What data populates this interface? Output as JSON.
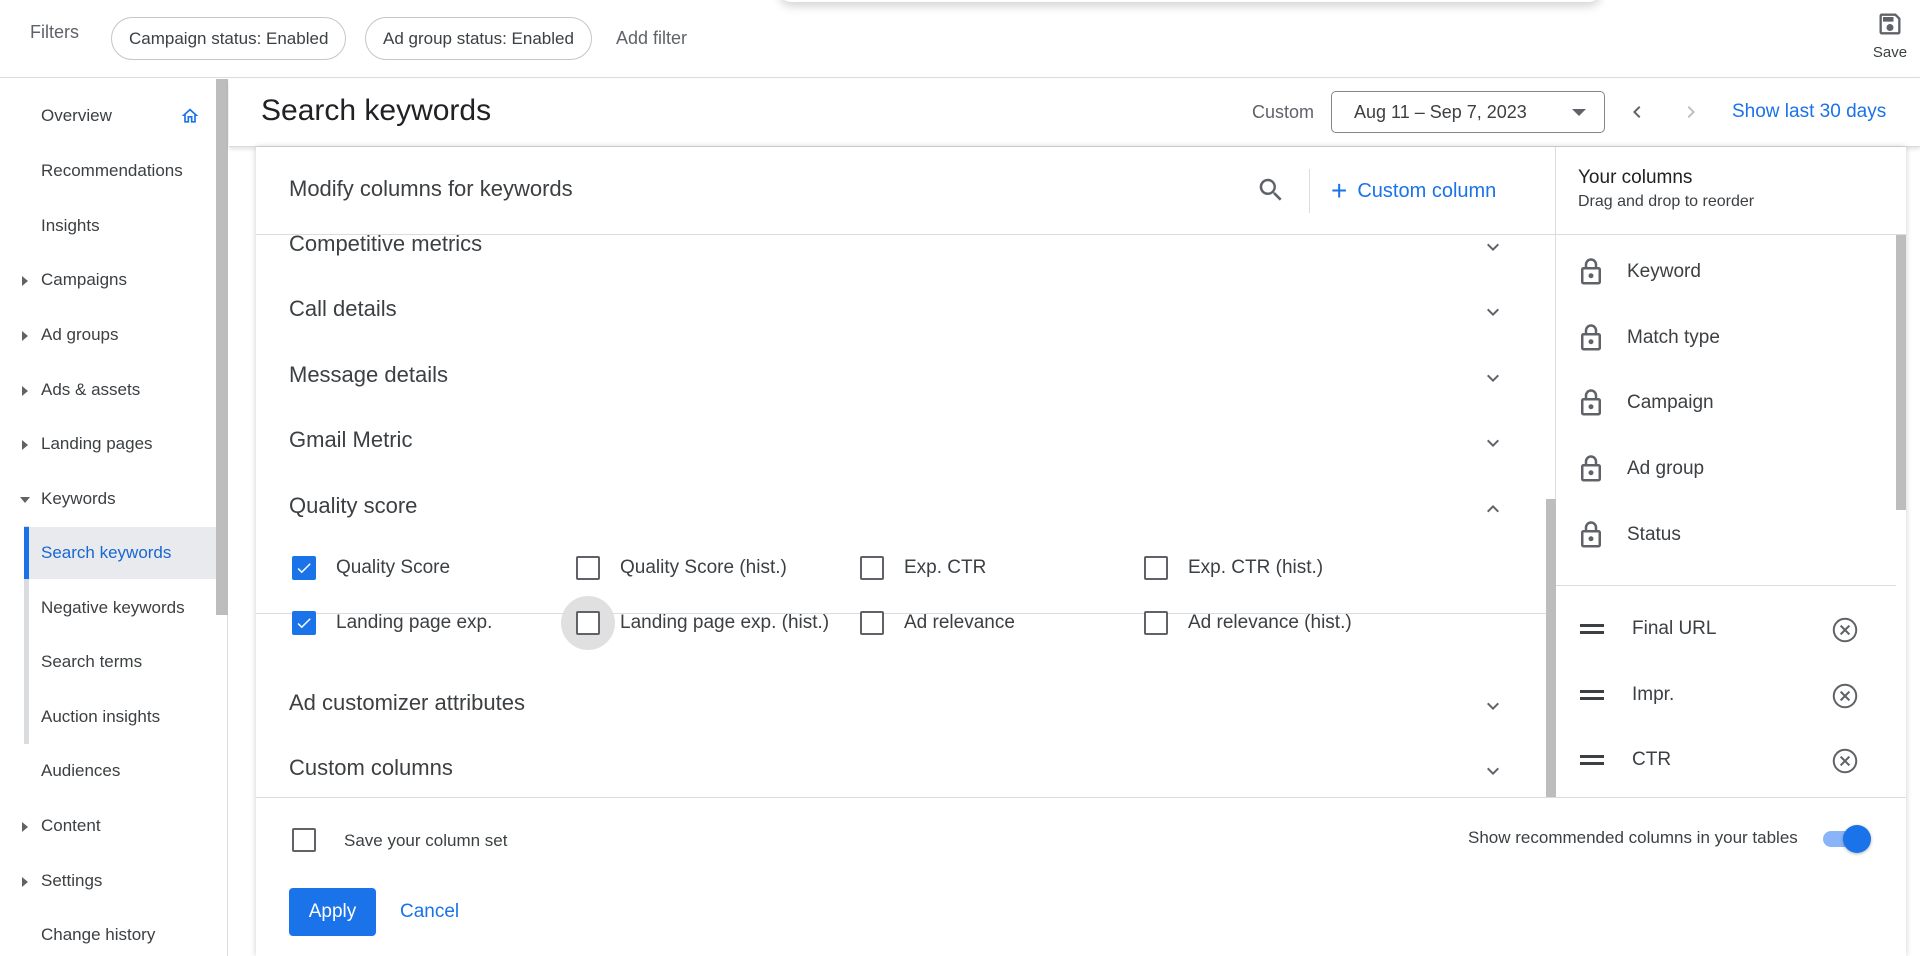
{
  "filter_bar": {
    "label": "Filters",
    "chips": [
      "Campaign status: Enabled",
      "Ad group status: Enabled"
    ],
    "add_filter": "Add filter",
    "save_label": "Save"
  },
  "sidebar": {
    "items": [
      {
        "label": "Overview"
      },
      {
        "label": "Recommendations"
      },
      {
        "label": "Insights"
      },
      {
        "label": "Campaigns"
      },
      {
        "label": "Ad groups"
      },
      {
        "label": "Ads & assets"
      },
      {
        "label": "Landing pages"
      },
      {
        "label": "Keywords"
      },
      {
        "label": "Search keywords"
      },
      {
        "label": "Negative keywords"
      },
      {
        "label": "Search terms"
      },
      {
        "label": "Auction insights"
      },
      {
        "label": "Audiences"
      },
      {
        "label": "Content"
      },
      {
        "label": "Settings"
      },
      {
        "label": "Change history"
      }
    ]
  },
  "header": {
    "title": "Search keywords",
    "range_type": "Custom",
    "date_range": "Aug 11 – Sep 7, 2023",
    "show_last": "Show last 30 days"
  },
  "modal": {
    "title": "Modify columns for keywords",
    "custom_column": "Custom column",
    "sections": [
      {
        "label": "Competitive metrics"
      },
      {
        "label": "Call details"
      },
      {
        "label": "Message details"
      },
      {
        "label": "Gmail Metric"
      },
      {
        "label": "Quality score"
      },
      {
        "label": "Ad customizer attributes"
      },
      {
        "label": "Custom columns"
      }
    ],
    "quality_score_options": [
      {
        "label": "Quality Score",
        "checked": true
      },
      {
        "label": "Quality Score (hist.)",
        "checked": false
      },
      {
        "label": "Exp. CTR",
        "checked": false
      },
      {
        "label": "Exp. CTR (hist.)",
        "checked": false
      },
      {
        "label": "Landing page exp.",
        "checked": true
      },
      {
        "label": "Landing page exp. (hist.)",
        "checked": false
      },
      {
        "label": "Ad relevance",
        "checked": false
      },
      {
        "label": "Ad relevance (hist.)",
        "checked": false
      }
    ],
    "your_columns": {
      "title": "Your columns",
      "subtitle": "Drag and drop to reorder",
      "locked": [
        "Keyword",
        "Match type",
        "Campaign",
        "Ad group",
        "Status"
      ],
      "movable": [
        "Final URL",
        "Impr.",
        "CTR"
      ]
    },
    "footer": {
      "save_set": "Save your column set",
      "save_set_checked": false,
      "show_recommended": "Show recommended columns in your tables",
      "show_recommended_on": true,
      "apply": "Apply",
      "cancel": "Cancel"
    }
  },
  "colors": {
    "accent": "#1a73e8",
    "active_nav_bg": "#e8eaed",
    "border": "#dadce0",
    "text": "#3c4043"
  }
}
